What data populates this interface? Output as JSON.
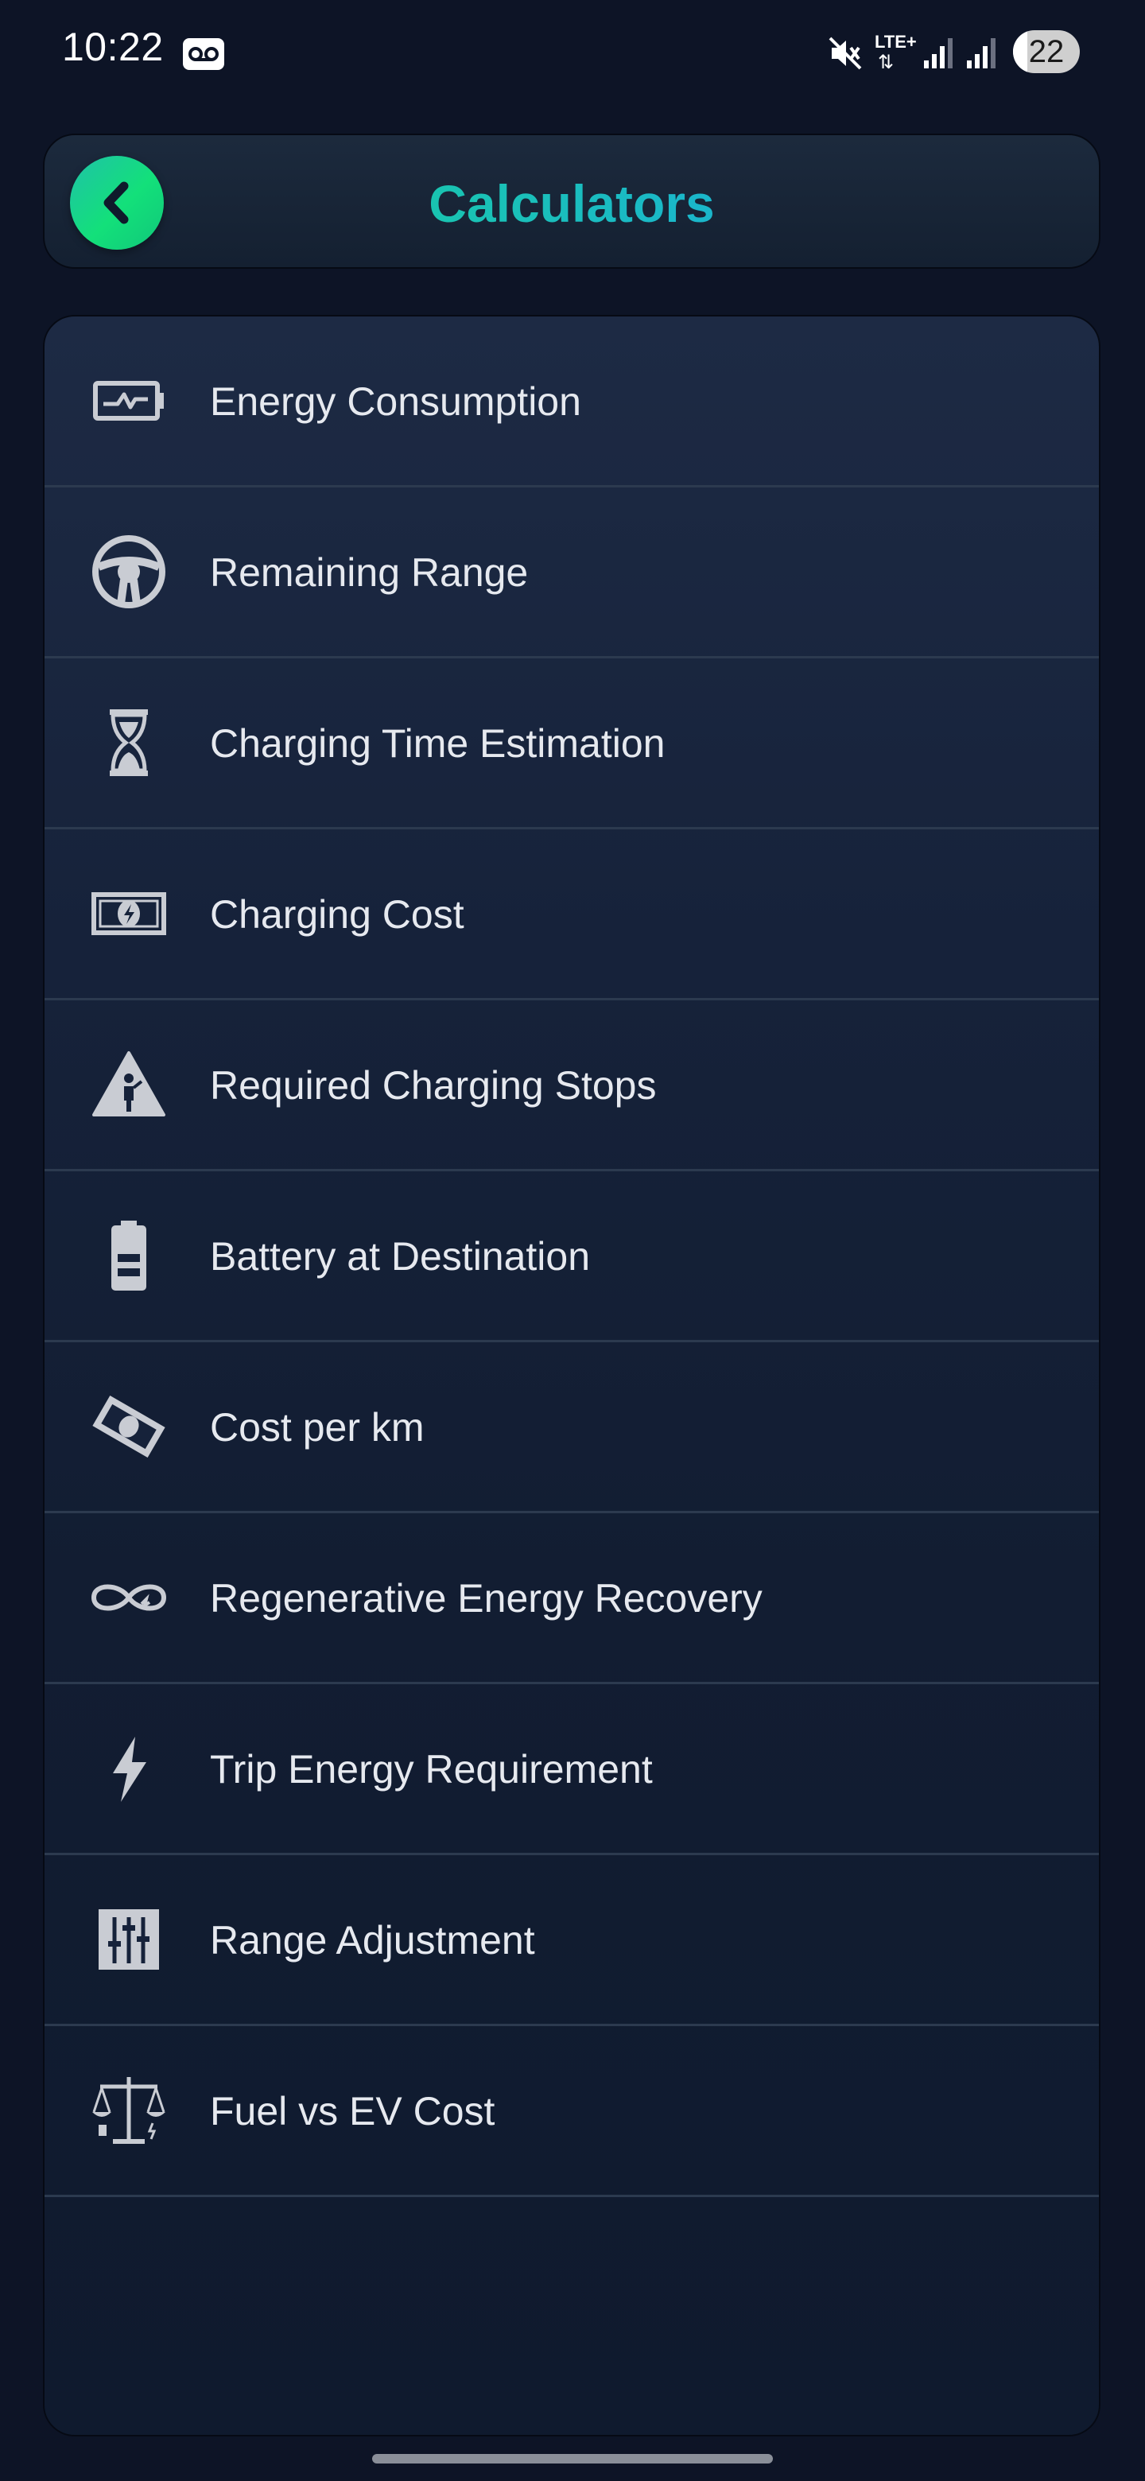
{
  "status_bar": {
    "time": "10:22",
    "network": "LTE+",
    "battery": "22",
    "battery_level": 0.22
  },
  "header": {
    "title": "Calculators",
    "back_icon": "chevron-left-icon"
  },
  "colors": {
    "background": "#0d1426",
    "accent_green": "#13e07a",
    "accent_blue": "#22a4e6",
    "icon_gray": "#c9ccd3"
  },
  "calculators": [
    {
      "label": "Energy Consumption",
      "icon": "battery-pulse-icon"
    },
    {
      "label": "Remaining Range",
      "icon": "steering-wheel-icon"
    },
    {
      "label": "Charging Time Estimation",
      "icon": "hourglass-icon"
    },
    {
      "label": "Charging Cost",
      "icon": "banknote-bolt-icon"
    },
    {
      "label": "Required Charging Stops",
      "icon": "warning-person-icon"
    },
    {
      "label": "Battery at Destination",
      "icon": "battery-icon"
    },
    {
      "label": "Cost per km",
      "icon": "money-tilted-icon"
    },
    {
      "label": "Regenerative Energy Recovery",
      "icon": "infinity-recharge-icon"
    },
    {
      "label": "Trip Energy Requirement",
      "icon": "lightning-icon"
    },
    {
      "label": "Range Adjustment",
      "icon": "sliders-icon"
    },
    {
      "label": "Fuel vs EV Cost",
      "icon": "balance-scale-icon"
    }
  ]
}
